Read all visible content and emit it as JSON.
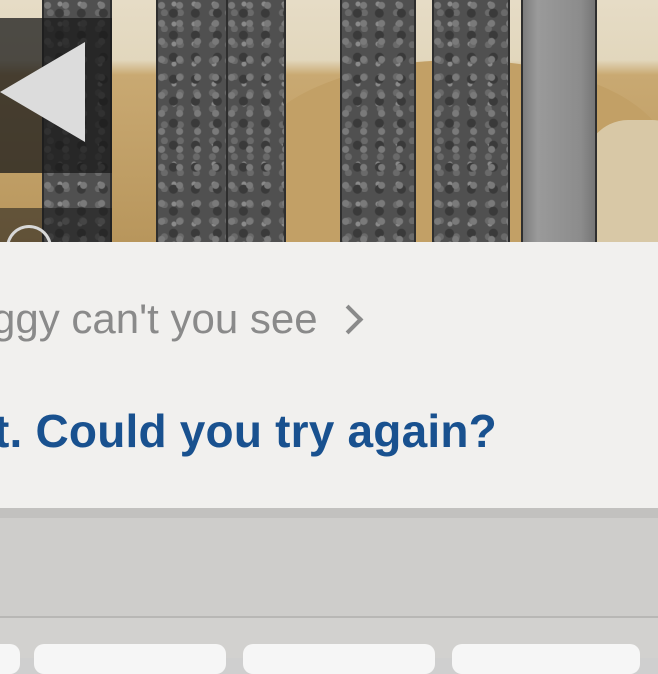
{
  "game_view": {
    "controls": [
      "left-arrow-button",
      "jump-button"
    ]
  },
  "suggestion": {
    "query_text": "ggy can't you see",
    "answer_text": "t. Could you try again?"
  },
  "keyboard": {
    "visible_keys": 3
  }
}
